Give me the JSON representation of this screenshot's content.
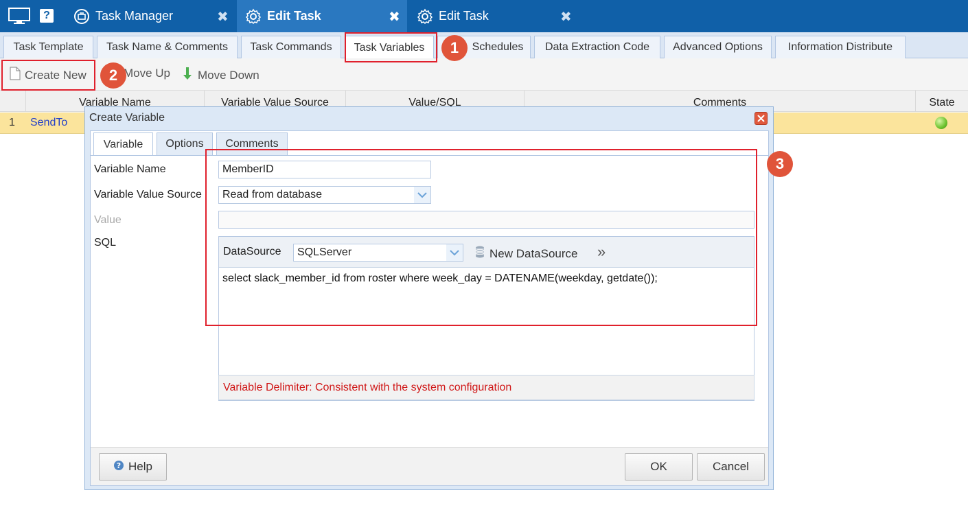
{
  "doc_tabs": [
    {
      "label": "Task Manager"
    },
    {
      "label": "Edit Task"
    },
    {
      "label": "Edit Task"
    }
  ],
  "help_glyph": "?",
  "close_glyph": "✖",
  "sub_tabs": [
    "Task Template",
    "Task Name & Comments",
    "Task Commands",
    "Task Variables",
    "Schedules",
    "Data Extraction Code",
    "Advanced Options",
    "Information Distribute"
  ],
  "toolbar": {
    "create_new": "Create New",
    "move_up": "Move Up",
    "move_down": "Move Down"
  },
  "grid": {
    "columns": [
      "Variable Name",
      "Variable Value Source",
      "Value/SQL",
      "Comments",
      "State"
    ],
    "rows": [
      {
        "num": "1",
        "name": "SendTo"
      }
    ]
  },
  "dialog": {
    "title": "Create Variable",
    "tabs": [
      "Variable",
      "Options",
      "Comments"
    ],
    "labels": {
      "variable_name": "Variable Name",
      "value_source": "Variable Value Source",
      "value": "Value",
      "sql": "SQL"
    },
    "variable_name_value": "MemberID",
    "value_source_selected": "Read from database",
    "value_value": "",
    "datasource_label": "DataSource",
    "datasource_selected": "SQLServer",
    "new_datasource": "New DataSource",
    "more_glyph": "»",
    "sql_text": "select slack_member_id from roster where week_day = DATENAME(weekday, getdate());",
    "delimiter_note": "Variable Delimiter: Consistent with the system configuration",
    "help": "Help",
    "ok": "OK",
    "cancel": "Cancel"
  },
  "annotations": [
    "1",
    "2",
    "3"
  ],
  "colors": {
    "titlebar": "#1060a8",
    "active_tab": "#2a78c0",
    "highlight_row": "#fbe49c",
    "annotation": "#e0543a",
    "redbox": "#e0202c"
  }
}
